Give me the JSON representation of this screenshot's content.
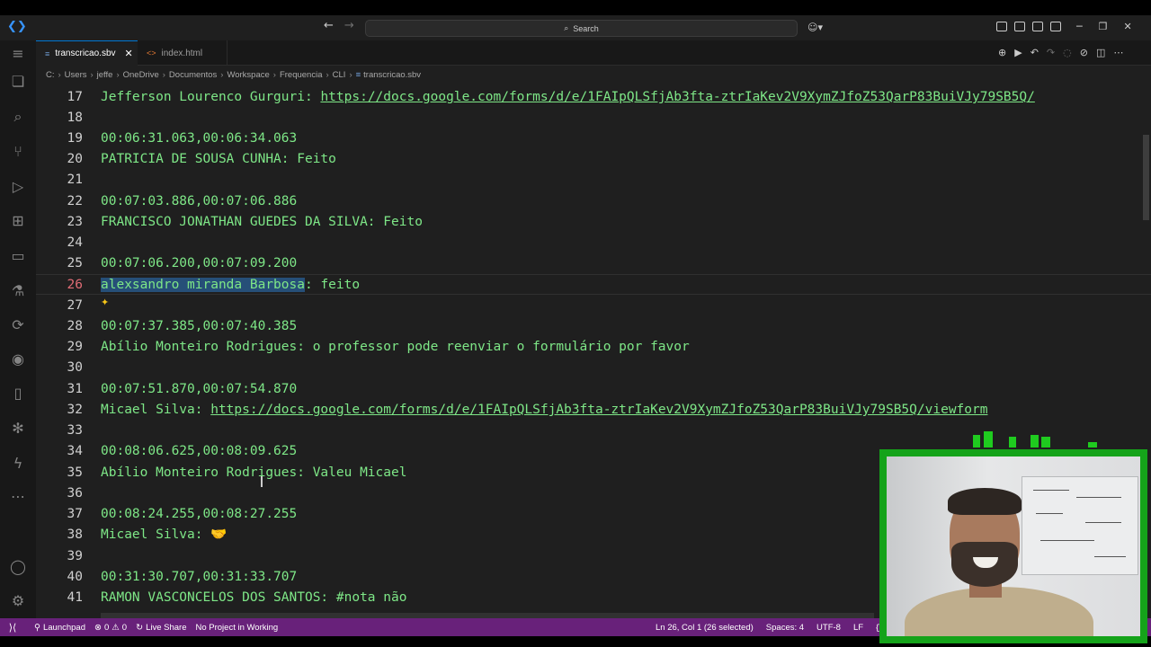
{
  "titlebar": {
    "search_placeholder": "Search"
  },
  "tabs": [
    {
      "label": "transcricao.sbv",
      "active": true
    },
    {
      "label": "index.html",
      "active": false
    }
  ],
  "breadcrumb": [
    "C:",
    "Users",
    "jeffe",
    "OneDrive",
    "Documentos",
    "Workspace",
    "Frequencia",
    "CLI",
    "transcricao.sbv"
  ],
  "editor": {
    "lines": [
      {
        "n": "17",
        "text": "Jefferson Lourenco Gurguri: ",
        "url": "https://docs.google.com/forms/d/e/1FAIpQLSfjAb3fta-ztrIaKev2V9XymZJfoZ53QarP83BuiVJy79SB5Q/"
      },
      {
        "n": "18",
        "text": ""
      },
      {
        "n": "19",
        "text": "00:06:31.063,00:06:34.063"
      },
      {
        "n": "20",
        "text": "PATRICIA DE SOUSA CUNHA: Feito"
      },
      {
        "n": "21",
        "text": ""
      },
      {
        "n": "22",
        "text": "00:07:03.886,00:07:06.886"
      },
      {
        "n": "23",
        "text": "FRANCISCO JONATHAN GUEDES DA SILVA: Feito"
      },
      {
        "n": "24",
        "text": ""
      },
      {
        "n": "25",
        "text": "00:07:06.200,00:07:09.200"
      },
      {
        "n": "26",
        "selected": "alexsandro miranda Barbosa",
        "text": ": feito",
        "current": true
      },
      {
        "n": "27",
        "text": ""
      },
      {
        "n": "28",
        "text": "00:07:37.385,00:07:40.385"
      },
      {
        "n": "29",
        "text": "Abílio Monteiro Rodrigues: o professor pode reenviar o formulário por favor"
      },
      {
        "n": "30",
        "text": ""
      },
      {
        "n": "31",
        "text": "00:07:51.870,00:07:54.870"
      },
      {
        "n": "32",
        "text": "Micael Silva: ",
        "url": "https://docs.google.com/forms/d/e/1FAIpQLSfjAb3fta-ztrIaKev2V9XymZJfoZ53QarP83BuiVJy79SB5Q/viewform"
      },
      {
        "n": "33",
        "text": ""
      },
      {
        "n": "34",
        "text": "00:08:06.625,00:08:09.625"
      },
      {
        "n": "35",
        "text": "Abílio Monteiro Rodrigues: Valeu Micael"
      },
      {
        "n": "36",
        "text": ""
      },
      {
        "n": "37",
        "text": "00:08:24.255,00:08:27.255"
      },
      {
        "n": "38",
        "text": "Micael Silva: ",
        "emoji": "🤝"
      },
      {
        "n": "39",
        "text": ""
      },
      {
        "n": "40",
        "text": "00:31:30.707,00:31:33.707"
      },
      {
        "n": "41",
        "text": "RAMON VASCONCELOS DOS SANTOS: #nota não"
      }
    ]
  },
  "statusbar": {
    "launchpad": "Launchpad",
    "errors": "0",
    "warnings": "0",
    "live_share": "Live Share",
    "project": "No Project in Working",
    "cursor_pos": "Ln 26, Col 1 (26 selected)",
    "spaces": "Spaces: 4",
    "encoding": "UTF-8",
    "eol": "LF",
    "language": "{}"
  },
  "colors": {
    "statusbar": "#68217a",
    "code_text": "#7ee787",
    "current_line_number": "#e06c75",
    "webcam_border": "#15a31a"
  }
}
